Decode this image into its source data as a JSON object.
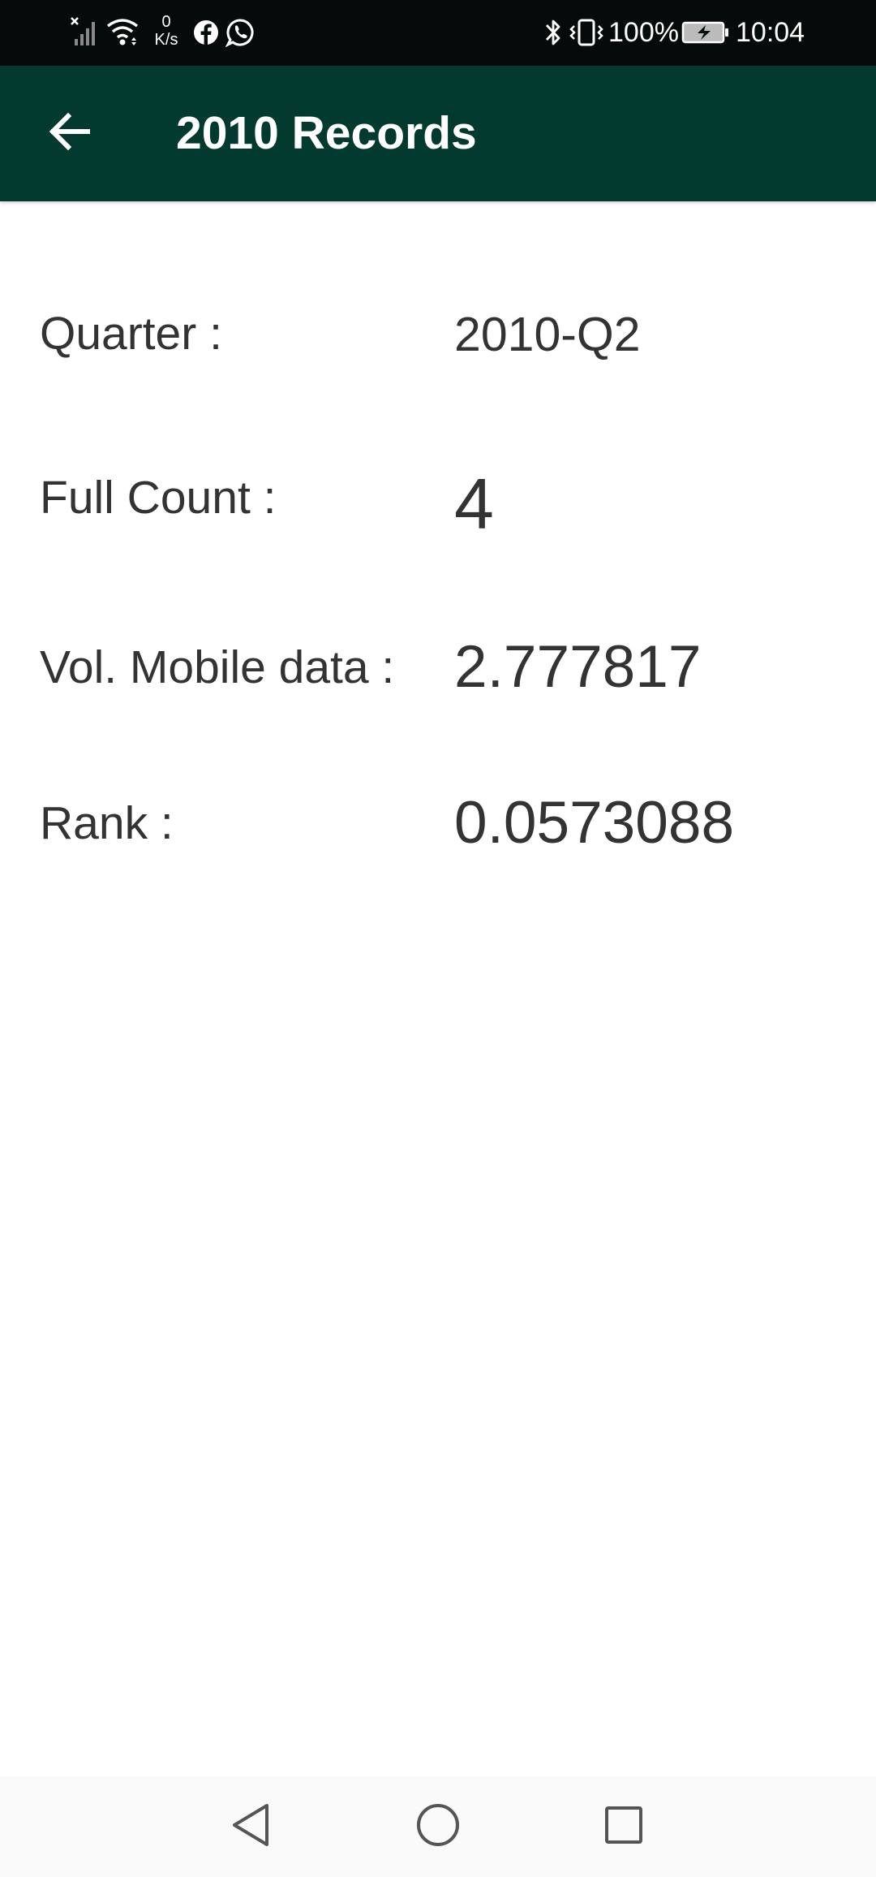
{
  "status_bar": {
    "net_speed_value": "0",
    "net_speed_unit": "K/s",
    "battery_percent": "100%",
    "time": "10:04",
    "icons": [
      "signal-off-icon",
      "wifi-icon",
      "facebook-icon",
      "whatsapp-icon",
      "bluetooth-icon",
      "vibrate-icon",
      "battery-charging-icon"
    ]
  },
  "app_bar": {
    "title": "2010 Records",
    "back_icon": "arrow-left-icon"
  },
  "details": [
    {
      "label": "Quarter :",
      "value": "2010-Q2"
    },
    {
      "label": "Full Count :",
      "value": "4"
    },
    {
      "label": "Vol. Mobile data :",
      "value": "2.777817"
    },
    {
      "label": "Rank :",
      "value": "0.0573088"
    }
  ],
  "nav_bar": {
    "icons": [
      "back-triangle-icon",
      "home-circle-icon",
      "recents-square-icon"
    ]
  },
  "colors": {
    "status_bar_bg": "#050b0a",
    "app_bar_bg": "#023a30",
    "text": "#333333",
    "nav_bar_bg": "#fafafa"
  }
}
